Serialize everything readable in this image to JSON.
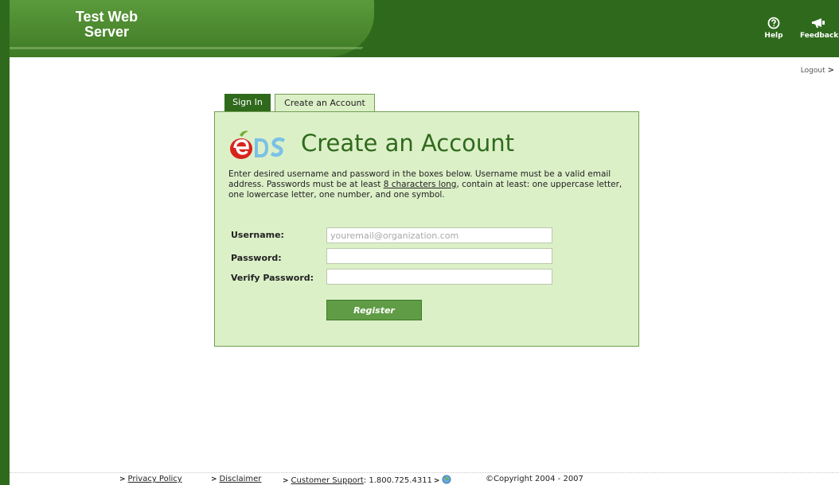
{
  "header": {
    "brand_line1": "Test Web",
    "brand_line2": "Server",
    "help_label": "Help",
    "feedback_label": "Feedback"
  },
  "logout_label": "Logout",
  "tabs": [
    {
      "label": "Sign In",
      "active": false
    },
    {
      "label": "Create an Account",
      "active": true
    }
  ],
  "panel": {
    "logo_text": "eDS",
    "title": "Create an Account",
    "instructions_part1": "Enter desired username and password in the boxes below. Username must be a valid email address. Passwords must be at least ",
    "instructions_link": "8 characters long",
    "instructions_part2": ", contain at least: one uppercase letter, one lowercase letter, one number, and one symbol."
  },
  "form": {
    "username_label": "Username:",
    "username_placeholder": "youremail@organization.com",
    "password_label": "Password:",
    "verify_label": "Verify Password:",
    "register_label": "Register"
  },
  "footer": {
    "privacy": "Privacy Policy",
    "disclaimer": "Disclaimer",
    "support": "Customer Support",
    "phone": ": 1.800.725.4311",
    "copyright": "©Copyright 2004 - 2007"
  },
  "colors": {
    "header_green": "#2f6a1c",
    "panel_bg": "#dcf0c8",
    "button_green": "#5f9c45",
    "logo_red": "#d8231b"
  }
}
